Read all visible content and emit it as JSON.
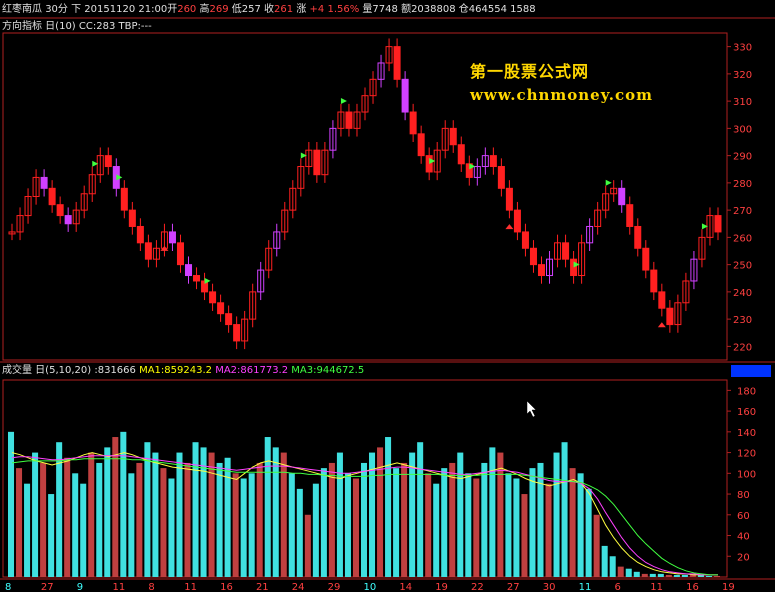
{
  "header": {
    "symbol": "红枣南瓜",
    "period": "30分",
    "direction": "下",
    "datetime": "20151120 21:00",
    "open_label": "开",
    "open": "260",
    "high_label": "高",
    "high": "269",
    "low_label": "低",
    "low": "257",
    "close_label": "收",
    "close": "261",
    "change_label": "涨",
    "change": "+4",
    "change_pct": "1.56%",
    "volume_label": "量",
    "volume": "7748",
    "amount_label": "额",
    "amount": "2038808",
    "oi_label": "仓",
    "oi": "464554",
    "oi_change": "1588"
  },
  "indicator_bar": {
    "name": "方向指标 日(10)",
    "cc": "CC:283",
    "tbp": "TBP:---"
  },
  "volume_bar": {
    "name": "成交量 日(5,10,20)",
    "value": ":831666",
    "ma1": "MA1:859243.2",
    "ma2": "MA2:861773.2",
    "ma3": "MA3:944672.5"
  },
  "watermark": {
    "line1": "第一股票公式网",
    "line2": "www.chnmoney.com"
  },
  "colors": {
    "up": "#ff2020",
    "down": "#40e0e0",
    "ma1": "#ffff40",
    "ma2": "#ff40ff",
    "ma3": "#40ff40",
    "axis": "#b02020"
  },
  "chart_data": [
    {
      "type": "line",
      "name": "price",
      "ylim": [
        215,
        335
      ],
      "yticks": [
        "330",
        "320",
        "310",
        "300",
        "290",
        "280",
        "270",
        "260",
        "250",
        "240",
        "230",
        "220"
      ],
      "points": [
        262,
        268,
        275,
        282,
        278,
        272,
        268,
        265,
        270,
        276,
        283,
        290,
        286,
        278,
        270,
        264,
        258,
        252,
        256,
        262,
        258,
        250,
        246,
        244,
        240,
        236,
        232,
        228,
        222,
        230,
        240,
        248,
        256,
        262,
        270,
        278,
        286,
        292,
        283,
        292,
        300,
        306,
        300,
        306,
        312,
        318,
        324,
        330,
        318,
        306,
        298,
        290,
        284,
        292,
        300,
        294,
        287,
        282,
        286,
        290,
        286,
        278,
        270,
        262,
        256,
        250,
        246,
        252,
        258,
        252,
        246,
        258,
        264,
        270,
        276,
        278,
        272,
        264,
        256,
        248,
        240,
        234,
        228,
        236,
        244,
        252,
        260,
        268,
        262
      ]
    },
    {
      "type": "bar",
      "name": "volume",
      "ylim": [
        0,
        190
      ],
      "yticks": [
        "180",
        "160",
        "140",
        "120",
        "100",
        "80",
        "60",
        "40",
        "20"
      ],
      "values": [
        140,
        105,
        90,
        120,
        110,
        80,
        130,
        115,
        100,
        90,
        120,
        110,
        125,
        135,
        140,
        100,
        110,
        130,
        120,
        105,
        95,
        120,
        110,
        130,
        125,
        120,
        110,
        115,
        100,
        95,
        100,
        110,
        135,
        125,
        120,
        100,
        85,
        60,
        90,
        105,
        110,
        120,
        100,
        95,
        110,
        120,
        125,
        135,
        105,
        110,
        120,
        130,
        100,
        90,
        105,
        110,
        120,
        100,
        95,
        110,
        125,
        120,
        100,
        95,
        80,
        105,
        110,
        90,
        120,
        130,
        105,
        100,
        85,
        60,
        30,
        20,
        10,
        8,
        5,
        3,
        3,
        3,
        2,
        2,
        2,
        2,
        2,
        1,
        1
      ],
      "ma": [
        {
          "name": "MA1",
          "values": [
            120,
            118,
            115,
            112,
            110,
            108,
            110,
            112,
            115,
            118,
            120,
            118,
            116,
            118,
            120,
            118,
            115,
            112,
            110,
            108,
            106,
            105,
            104,
            103,
            102,
            100,
            98,
            96,
            94,
            100,
            106,
            110,
            112,
            110,
            108,
            106,
            104,
            102,
            100,
            98,
            96,
            95,
            98,
            100,
            102,
            104,
            106,
            108,
            110,
            108,
            106,
            104,
            102,
            100,
            98,
            96,
            95,
            97,
            99,
            101,
            103,
            105,
            102,
            99,
            95,
            92,
            90,
            88,
            90,
            92,
            94,
            90,
            80,
            65,
            50,
            38,
            28,
            20,
            14,
            10,
            7,
            5,
            4,
            3,
            3,
            2,
            2,
            2,
            2
          ]
        },
        {
          "name": "MA2",
          "values": [
            115,
            116,
            116,
            115,
            114,
            113,
            113,
            114,
            115,
            116,
            117,
            117,
            117,
            117,
            117,
            116,
            115,
            114,
            113,
            112,
            111,
            110,
            109,
            108,
            107,
            106,
            105,
            104,
            103,
            104,
            105,
            106,
            107,
            107,
            107,
            106,
            105,
            104,
            103,
            102,
            101,
            100,
            100,
            101,
            102,
            103,
            104,
            105,
            106,
            106,
            105,
            104,
            103,
            102,
            101,
            100,
            99,
            99,
            100,
            101,
            102,
            103,
            102,
            101,
            99,
            97,
            95,
            93,
            92,
            92,
            92,
            90,
            85,
            75,
            62,
            50,
            38,
            28,
            20,
            14,
            10,
            7,
            5,
            4,
            3,
            3,
            2,
            2,
            2
          ]
        },
        {
          "name": "MA3",
          "values": [
            110,
            111,
            112,
            112,
            112,
            112,
            112,
            113,
            113,
            114,
            114,
            114,
            114,
            114,
            114,
            113,
            113,
            112,
            111,
            110,
            109,
            108,
            107,
            106,
            105,
            104,
            103,
            102,
            101,
            101,
            101,
            101,
            101,
            101,
            101,
            100,
            100,
            99,
            99,
            98,
            98,
            97,
            97,
            97,
            97,
            98,
            98,
            99,
            99,
            99,
            99,
            99,
            99,
            99,
            98,
            98,
            98,
            98,
            98,
            99,
            99,
            99,
            99,
            99,
            98,
            97,
            96,
            95,
            94,
            93,
            92,
            91,
            88,
            84,
            78,
            70,
            60,
            50,
            40,
            32,
            25,
            18,
            13,
            9,
            6,
            4,
            3,
            2,
            2
          ]
        }
      ]
    }
  ],
  "x_axis_labels": [
    "8",
    "27",
    "9",
    "11",
    "8",
    "11",
    "16",
    "21",
    "24",
    "29",
    "10",
    "14",
    "19",
    "22",
    "27",
    "30",
    "11",
    "6",
    "11",
    "16",
    "19"
  ],
  "x_axis_colors": [
    "#40ffff",
    "#ff4040",
    "#40ffff",
    "#ff4040",
    "#ff4040",
    "#ff4040",
    "#ff4040",
    "#ff4040",
    "#ff4040",
    "#ff4040",
    "#40ffff",
    "#ff4040",
    "#ff4040",
    "#ff4040",
    "#ff4040",
    "#ff4040",
    "#40ffff",
    "#ff4040",
    "#ff4040",
    "#ff4040",
    "#ff4040"
  ]
}
